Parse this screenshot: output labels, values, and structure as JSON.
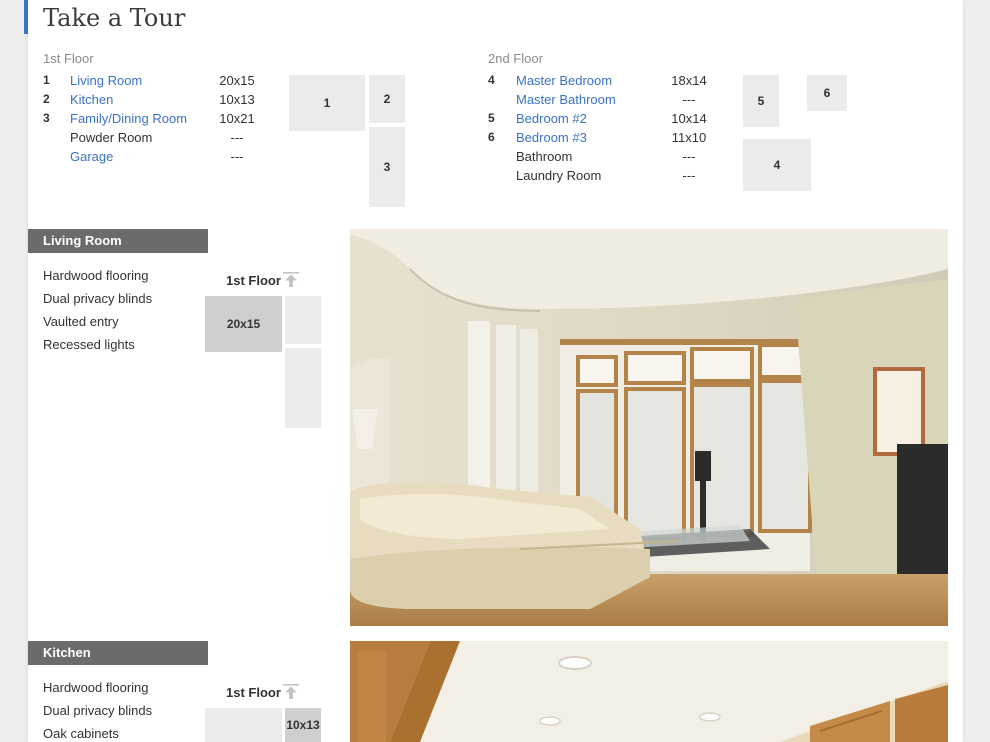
{
  "page": {
    "title": "Take a Tour"
  },
  "floor1": {
    "heading": "1st Floor",
    "rooms": [
      {
        "num": "1",
        "name": "Living Room",
        "dim": "20x15"
      },
      {
        "num": "2",
        "name": "Kitchen",
        "dim": "10x13"
      },
      {
        "num": "3",
        "name": "Family/Dining Room",
        "dim": "10x21"
      },
      {
        "num": "",
        "name": "Powder Room",
        "dim": "---"
      },
      {
        "num": "",
        "name": "Garage",
        "dim": "---"
      }
    ],
    "plan": [
      "1",
      "2",
      "3"
    ]
  },
  "floor2": {
    "heading": "2nd Floor",
    "rooms": [
      {
        "num": "4",
        "name": "Master Bedroom",
        "dim": "18x14"
      },
      {
        "num": "",
        "name": "Master Bathroom",
        "dim": "---"
      },
      {
        "num": "5",
        "name": "Bedroom #2",
        "dim": "10x14"
      },
      {
        "num": "6",
        "name": "Bedroom #3",
        "dim": "11x10"
      },
      {
        "num": "",
        "name": "Bathroom",
        "dim": "---"
      },
      {
        "num": "",
        "name": "Laundry Room",
        "dim": "---"
      }
    ],
    "plan": [
      "5",
      "6",
      "4"
    ]
  },
  "sections": [
    {
      "title": "Living Room",
      "features": [
        "Hardwood flooring",
        "Dual privacy blinds",
        "Vaulted entry",
        "Recessed lights"
      ],
      "mini_floor": "1st Floor",
      "mini_label": "20x15"
    },
    {
      "title": "Kitchen",
      "features": [
        "Hardwood flooring",
        "Dual privacy blinds",
        "Oak cabinets"
      ],
      "mini_floor": "1st Floor",
      "mini_label": "10x13"
    }
  ],
  "icons": {
    "back_to_top": "arrow-up-icon"
  },
  "colors": {
    "link": "#3a72c4",
    "accent": "#3a72c4",
    "section_bar": "#6b6b6b"
  }
}
